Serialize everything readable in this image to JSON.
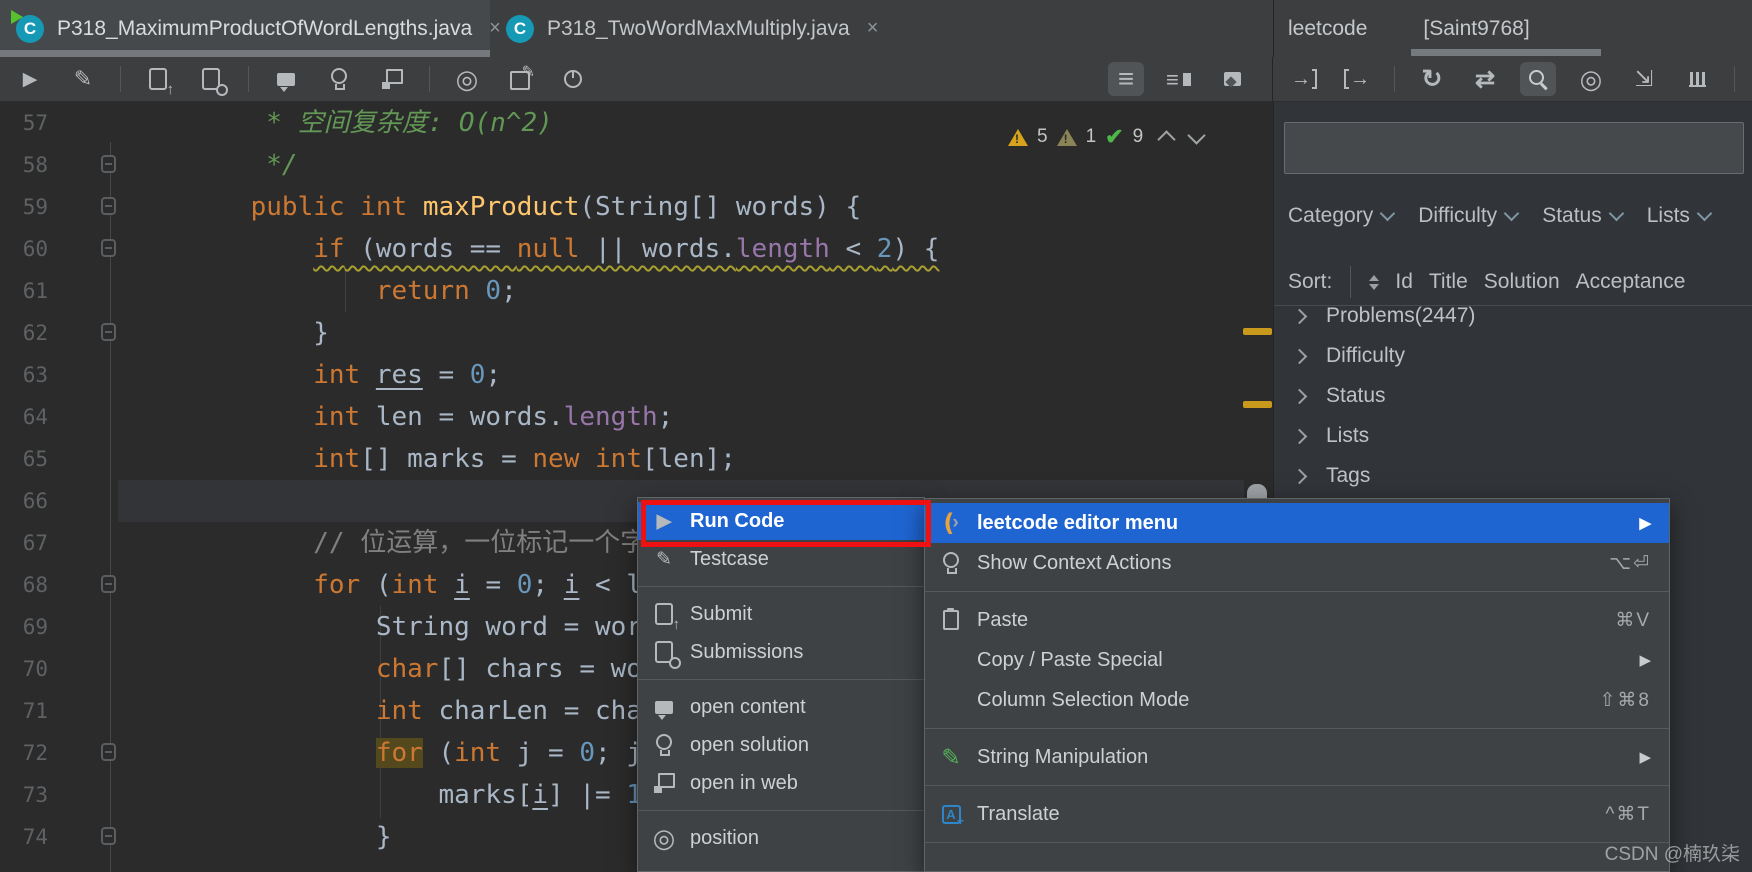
{
  "ui": {
    "close_glyph": "×",
    "submenu_glyph": "▶"
  },
  "tabs": [
    {
      "label": "P318_MaximumProductOfWordLengths.java",
      "active": true
    },
    {
      "label": "P318_TwoWordMaxMultiply.java",
      "active": false
    }
  ],
  "panel_header": {
    "title": "leetcode",
    "user": "[Saint9768]"
  },
  "toolbar": {
    "left_groups": [
      [
        {
          "name": "run"
        },
        {
          "name": "edit"
        }
      ],
      [
        {
          "name": "submit"
        },
        {
          "name": "submissions"
        }
      ],
      [
        {
          "name": "comment"
        },
        {
          "name": "lightbulb"
        },
        {
          "name": "window"
        }
      ],
      [
        {
          "name": "target"
        },
        {
          "name": "compose"
        },
        {
          "name": "timer"
        }
      ]
    ],
    "editor_view_group": [
      {
        "name": "list-view",
        "sel": true
      },
      {
        "name": "split-view"
      },
      {
        "name": "image-view"
      }
    ],
    "panel_groups": [
      [
        {
          "name": "sign-in"
        },
        {
          "name": "sign-out"
        }
      ],
      [
        {
          "name": "refresh"
        },
        {
          "name": "shuffle"
        },
        {
          "name": "search",
          "sel": true
        },
        {
          "name": "locate"
        },
        {
          "name": "collapse"
        },
        {
          "name": "chart"
        }
      ],
      [
        {
          "name": "settings"
        }
      ]
    ]
  },
  "inspections": {
    "warnings": "5",
    "weak_warnings": "1",
    "passed": "9"
  },
  "editor": {
    "first_line": 57,
    "line_numbers": [
      "57",
      "58",
      "59",
      "60",
      "61",
      "62",
      "63",
      "64",
      "65",
      "66",
      "67",
      "68",
      "69",
      "70",
      "71",
      "72",
      "73",
      "74"
    ],
    "fold_lines": [
      58,
      59,
      60,
      62,
      68,
      72,
      74
    ],
    "lines": [
      {
        "n": 57,
        "seg": [
          [
            "     * 空间复杂度: O(n^2)",
            "doc"
          ]
        ]
      },
      {
        "n": 58,
        "seg": [
          [
            "     */",
            "doc"
          ]
        ]
      },
      {
        "n": 59,
        "seg": [
          [
            "    ",
            "pl"
          ],
          [
            "public",
            "kw"
          ],
          [
            " ",
            "pl"
          ],
          [
            "int",
            "kw"
          ],
          [
            " ",
            "pl"
          ],
          [
            "maxProduct",
            "fn"
          ],
          [
            "(String[] words) {",
            "pl"
          ]
        ]
      },
      {
        "n": 60,
        "seg": [
          [
            "        ",
            "pl"
          ],
          [
            "if",
            "kw",
            "w"
          ],
          [
            " (words == ",
            "pl",
            "w"
          ],
          [
            "null",
            "kw",
            "w"
          ],
          [
            " || words.",
            "pl",
            "w"
          ],
          [
            "length",
            "field",
            "w"
          ],
          [
            " < ",
            "pl",
            "w"
          ],
          [
            "2",
            "num",
            "w"
          ],
          [
            ") {",
            "pl",
            "w"
          ]
        ]
      },
      {
        "n": 61,
        "seg": [
          [
            "            ",
            "pl"
          ],
          [
            "return",
            "kw"
          ],
          [
            " ",
            "pl"
          ],
          [
            "0",
            "num"
          ],
          [
            ";",
            "pl"
          ]
        ]
      },
      {
        "n": 62,
        "seg": [
          [
            "        }",
            "pl"
          ]
        ]
      },
      {
        "n": 63,
        "seg": [
          [
            "        ",
            "pl"
          ],
          [
            "int",
            "kw"
          ],
          [
            " ",
            "pl"
          ],
          [
            "res",
            "und"
          ],
          [
            " = ",
            "pl"
          ],
          [
            "0",
            "num"
          ],
          [
            ";",
            "pl"
          ]
        ]
      },
      {
        "n": 64,
        "seg": [
          [
            "        ",
            "pl"
          ],
          [
            "int",
            "kw"
          ],
          [
            " len = words.",
            "pl"
          ],
          [
            "length",
            "field"
          ],
          [
            ";",
            "pl"
          ]
        ]
      },
      {
        "n": 65,
        "seg": [
          [
            "        ",
            "pl"
          ],
          [
            "int",
            "kw"
          ],
          [
            "[] marks = ",
            "pl"
          ],
          [
            "new",
            "kw"
          ],
          [
            " ",
            "pl"
          ],
          [
            "int",
            "kw"
          ],
          [
            "[len];",
            "pl"
          ]
        ]
      },
      {
        "n": 66,
        "seg": []
      },
      {
        "n": 67,
        "seg": [
          [
            "        ",
            "pl"
          ],
          [
            "// 位运算，一位标记一个字",
            "cmt"
          ]
        ]
      },
      {
        "n": 68,
        "seg": [
          [
            "        ",
            "pl"
          ],
          [
            "for",
            "kw"
          ],
          [
            " (",
            "pl"
          ],
          [
            "int",
            "kw"
          ],
          [
            " ",
            "pl"
          ],
          [
            "i",
            "und"
          ],
          [
            " = ",
            "pl"
          ],
          [
            "0",
            "num"
          ],
          [
            "; ",
            "pl"
          ],
          [
            "i",
            "und"
          ],
          [
            " < l",
            "pl"
          ]
        ]
      },
      {
        "n": 69,
        "seg": [
          [
            "            String word = wor",
            "pl"
          ]
        ]
      },
      {
        "n": 70,
        "seg": [
          [
            "            ",
            "pl"
          ],
          [
            "char",
            "kw"
          ],
          [
            "[] chars = wo",
            "pl"
          ]
        ]
      },
      {
        "n": 71,
        "seg": [
          [
            "            ",
            "pl"
          ],
          [
            "int",
            "kw"
          ],
          [
            " charLen = cha",
            "pl"
          ]
        ]
      },
      {
        "n": 72,
        "seg": [
          [
            "            ",
            "pl"
          ],
          [
            "for",
            "hlkw"
          ],
          [
            " (",
            "pl"
          ],
          [
            "int",
            "kw"
          ],
          [
            " j = ",
            "pl"
          ],
          [
            "0",
            "num"
          ],
          [
            "; j",
            "pl"
          ]
        ]
      },
      {
        "n": 73,
        "seg": [
          [
            "                marks[",
            "pl"
          ],
          [
            "i",
            "und"
          ],
          [
            "] |= ",
            "pl"
          ],
          [
            "1",
            "num"
          ]
        ]
      },
      {
        "n": 74,
        "seg": [
          [
            "            }",
            "pl"
          ]
        ]
      }
    ]
  },
  "left_menu": {
    "items": [
      {
        "icon": "run",
        "label": "Run Code",
        "selected": true
      },
      {
        "icon": "testcase",
        "label": "Testcase"
      },
      {
        "type": "sep"
      },
      {
        "icon": "submit",
        "label": "Submit"
      },
      {
        "icon": "submissions",
        "label": "Submissions"
      },
      {
        "type": "sep"
      },
      {
        "icon": "comment",
        "label": "open content"
      },
      {
        "icon": "lightbulb",
        "label": "open solution"
      },
      {
        "icon": "window",
        "label": "open in web"
      },
      {
        "type": "sep"
      },
      {
        "icon": "target",
        "label": "position"
      }
    ]
  },
  "context_menu": {
    "items": [
      {
        "icon": "leetcode",
        "label": "leetcode editor menu",
        "submenu": true,
        "selected": true
      },
      {
        "icon": "lightbulb",
        "label": "Show Context Actions",
        "shortcut": "⌥⏎"
      },
      {
        "type": "sep"
      },
      {
        "icon": "paste",
        "label": "Paste",
        "shortcut": "⌘V"
      },
      {
        "label": "Copy / Paste Special",
        "submenu": true
      },
      {
        "label": "Column Selection Mode",
        "shortcut": "⇧⌘8"
      },
      {
        "type": "sep"
      },
      {
        "icon": "pencil-green",
        "label": "String Manipulation",
        "submenu": true
      },
      {
        "type": "sep"
      },
      {
        "icon": "translate",
        "label": "Translate",
        "shortcut": "^⌘T"
      },
      {
        "type": "sep"
      }
    ]
  },
  "panel": {
    "search_value": "",
    "filters": [
      "Category",
      "Difficulty",
      "Status",
      "Lists"
    ],
    "sort_label": "Sort:",
    "sort_options": [
      "Id",
      "Title",
      "Solution",
      "Acceptance"
    ],
    "tree": [
      "Problems(2447)",
      "Difficulty",
      "Status",
      "Lists",
      "Tags"
    ]
  },
  "watermark": "CSDN @楠玖柒",
  "colors": {
    "selection_blue": "#1f65d2",
    "annotation_red": "#ee1111",
    "warning_gold": "#d8a31c",
    "weak_warning_olive": "#8a8456",
    "passed_green": "#4db848",
    "stripe_gold": "#c8991b",
    "tab_icon_teal": "#1699b4",
    "run_overlay_green": "#57c22d"
  }
}
